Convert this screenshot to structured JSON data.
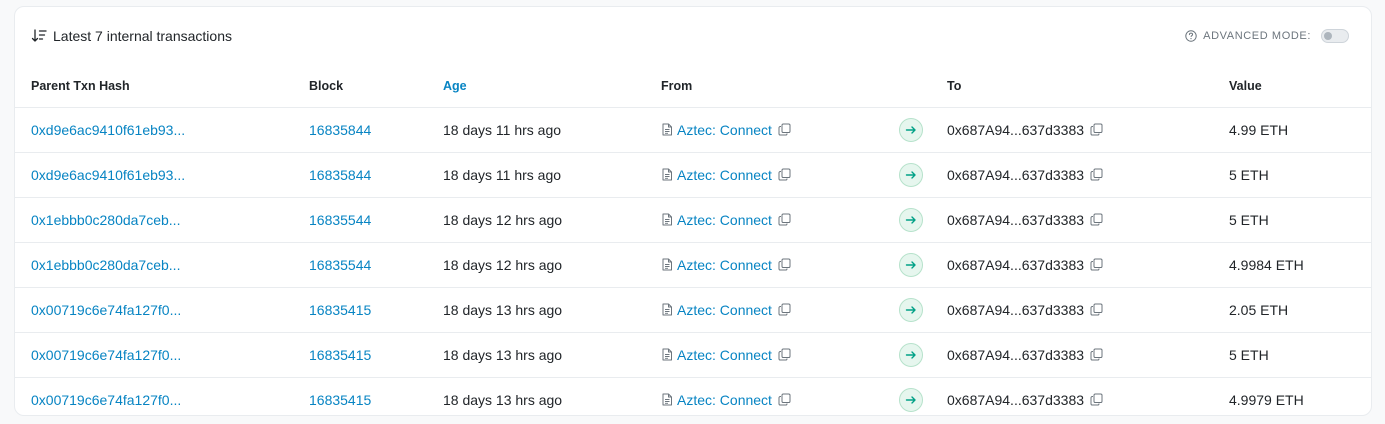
{
  "header": {
    "title": "Latest 7 internal transactions",
    "advanced_mode_label": "ADVANCED MODE:",
    "advanced_mode_on": false
  },
  "columns": {
    "hash": "Parent Txn Hash",
    "block": "Block",
    "age": "Age",
    "from": "From",
    "to": "To",
    "value": "Value"
  },
  "rows": [
    {
      "hash": "0xd9e6ac9410f61eb93...",
      "block": "16835844",
      "age": "18 days 11 hrs ago",
      "from": "Aztec: Connect",
      "to": "0x687A94...637d3383",
      "value": "4.99 ETH"
    },
    {
      "hash": "0xd9e6ac9410f61eb93...",
      "block": "16835844",
      "age": "18 days 11 hrs ago",
      "from": "Aztec: Connect",
      "to": "0x687A94...637d3383",
      "value": "5 ETH"
    },
    {
      "hash": "0x1ebbb0c280da7ceb...",
      "block": "16835544",
      "age": "18 days 12 hrs ago",
      "from": "Aztec: Connect",
      "to": "0x687A94...637d3383",
      "value": "5 ETH"
    },
    {
      "hash": "0x1ebbb0c280da7ceb...",
      "block": "16835544",
      "age": "18 days 12 hrs ago",
      "from": "Aztec: Connect",
      "to": "0x687A94...637d3383",
      "value": "4.9984 ETH"
    },
    {
      "hash": "0x00719c6e74fa127f0...",
      "block": "16835415",
      "age": "18 days 13 hrs ago",
      "from": "Aztec: Connect",
      "to": "0x687A94...637d3383",
      "value": "2.05 ETH"
    },
    {
      "hash": "0x00719c6e74fa127f0...",
      "block": "16835415",
      "age": "18 days 13 hrs ago",
      "from": "Aztec: Connect",
      "to": "0x687A94...637d3383",
      "value": "5 ETH"
    },
    {
      "hash": "0x00719c6e74fa127f0...",
      "block": "16835415",
      "age": "18 days 13 hrs ago",
      "from": "Aztec: Connect",
      "to": "0x687A94...637d3383",
      "value": "4.9979 ETH"
    }
  ],
  "icons": {
    "sort": "sort-descending-icon",
    "help": "question-circle-icon",
    "contract": "document-icon",
    "copy": "copy-icon",
    "direction": "arrow-right-icon"
  },
  "colors": {
    "link": "#0784c3",
    "arrow": "#00a186",
    "arrow_bg": "#e6f6ee"
  }
}
